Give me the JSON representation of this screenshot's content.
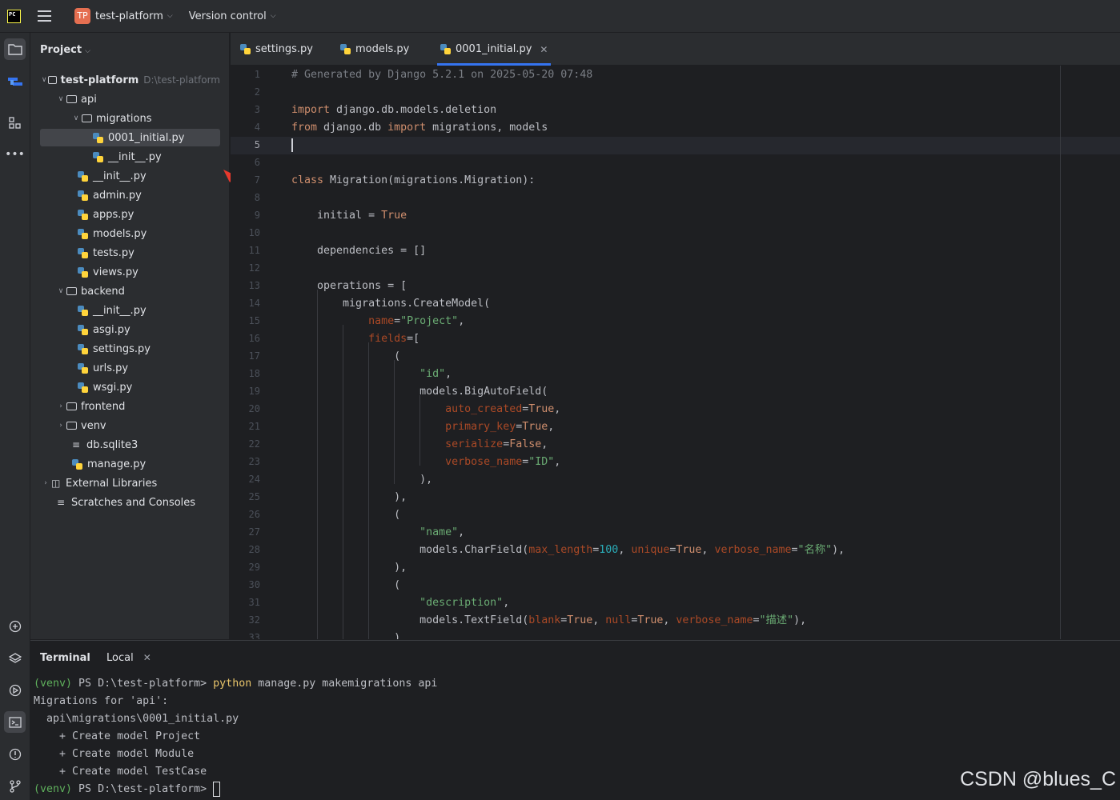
{
  "titlebar": {
    "logo_text": "PC",
    "project_badge": "TP",
    "project_name": "test-platform",
    "vcs_label": "Version control"
  },
  "project_panel": {
    "title": "Project",
    "root_name": "test-platform",
    "root_path": "D:\\test-platform",
    "items": {
      "api": "api",
      "migrations": "migrations",
      "initial": "0001_initial.py",
      "mig_init": "__init__.py",
      "api_init": "__init__.py",
      "admin": "admin.py",
      "apps": "apps.py",
      "models": "models.py",
      "tests": "tests.py",
      "views": "views.py",
      "backend": "backend",
      "be_init": "__init__.py",
      "asgi": "asgi.py",
      "settings": "settings.py",
      "urls": "urls.py",
      "wsgi": "wsgi.py",
      "frontend": "frontend",
      "venv": "venv",
      "db": "db.sqlite3",
      "manage": "manage.py",
      "external": "External Libraries",
      "scratches": "Scratches and Consoles"
    }
  },
  "editor": {
    "tabs": [
      "settings.py",
      "models.py",
      "0001_initial.py"
    ],
    "active_tab": "0001_initial.py",
    "current_line": 5,
    "line_numbers": [
      "1",
      "2",
      "3",
      "4",
      "5",
      "6",
      "7",
      "8",
      "9",
      "10",
      "11",
      "12",
      "13",
      "14",
      "15",
      "16",
      "17",
      "18",
      "19",
      "20",
      "21",
      "22",
      "23",
      "24",
      "25",
      "26",
      "27",
      "28",
      "29",
      "30",
      "31",
      "32",
      "33"
    ],
    "code": {
      "l1": "# Generated by Django 5.2.1 on 2025-05-20 07:48",
      "l3_kw": "import",
      "l3_rest": " django.db.models.deletion",
      "l4_kw1": "from",
      "l4_mid": " django.db ",
      "l4_kw2": "import",
      "l4_rest": " migrations, models",
      "l7_kw": "class",
      "l7_rest": " Migration(migrations.Migration):",
      "l9_a": "    initial = ",
      "l9_b": "True",
      "l11": "    dependencies = []",
      "l13": "    operations = [",
      "l14": "        migrations.CreateModel(",
      "l15_indent": "            ",
      "l15_p": "name",
      "l15_eq": "=",
      "l15_s": "\"Project\"",
      "l15_end": ",",
      "l16_indent": "            ",
      "l16_p": "fields",
      "l16_end": "=[",
      "l17": "                (",
      "l18_indent": "                    ",
      "l18_s": "\"id\"",
      "l18_end": ",",
      "l19": "                    models.BigAutoField(",
      "l20_indent": "                        ",
      "l20_p": "auto_created",
      "l20_eq": "=",
      "l20_v": "True",
      "l20_end": ",",
      "l21_indent": "                        ",
      "l21_p": "primary_key",
      "l21_eq": "=",
      "l21_v": "True",
      "l21_end": ",",
      "l22_indent": "                        ",
      "l22_p": "serialize",
      "l22_eq": "=",
      "l22_v": "False",
      "l22_end": ",",
      "l23_indent": "                        ",
      "l23_p": "verbose_name",
      "l23_eq": "=",
      "l23_s": "\"ID\"",
      "l23_end": ",",
      "l24": "                    ),",
      "l25": "                ),",
      "l26": "                (",
      "l27_indent": "                    ",
      "l27_s": "\"name\"",
      "l27_end": ",",
      "l28_a": "                    models.CharField(",
      "l28_p1": "max_length",
      "l28_eq1": "=",
      "l28_n": "100",
      "l28_c1": ", ",
      "l28_p2": "unique",
      "l28_eq2": "=",
      "l28_v": "True",
      "l28_c2": ", ",
      "l28_p3": "verbose_name",
      "l28_eq3": "=",
      "l28_s": "\"名称\"",
      "l28_end": "),",
      "l29": "                ),",
      "l30": "                (",
      "l31_indent": "                    ",
      "l31_s": "\"description\"",
      "l31_end": ",",
      "l32_a": "                    models.TextField(",
      "l32_p1": "blank",
      "l32_eq1": "=",
      "l32_v1": "True",
      "l32_c1": ", ",
      "l32_p2": "null",
      "l32_eq2": "=",
      "l32_v2": "True",
      "l32_c2": ", ",
      "l32_p3": "verbose_name",
      "l32_eq3": "=",
      "l32_s": "\"描述\"",
      "l32_end": "),",
      "l33": "                )"
    }
  },
  "terminal": {
    "title": "Terminal",
    "tab": "Local",
    "prompt_venv": "(venv)",
    "prompt_path": " PS D:\\test-platform> ",
    "cmd_word": "python",
    "cmd_rest": " manage.py makemigrations api",
    "out1": "Migrations for 'api':",
    "out2": "  api\\migrations\\0001_initial.py",
    "out3": "    + Create model Project",
    "out4": "    + Create model Module",
    "out5": "    + Create model TestCase"
  },
  "watermark": "CSDN @blues_C"
}
